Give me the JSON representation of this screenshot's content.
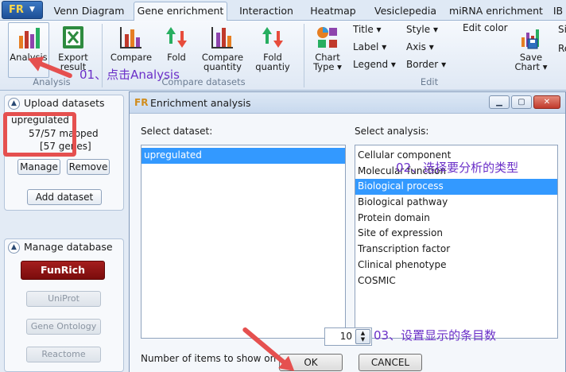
{
  "app": {
    "logo": "FR"
  },
  "tabs": [
    {
      "label": "Venn Diagram",
      "active": false
    },
    {
      "label": "Gene enrichment",
      "active": true
    },
    {
      "label": "Interaction",
      "active": false
    },
    {
      "label": "Heatmap",
      "active": false
    },
    {
      "label": "Vesiclepedia",
      "active": false
    },
    {
      "label": "miRNA enrichment",
      "active": false
    },
    {
      "label": "IB",
      "active": false
    }
  ],
  "ribbon": {
    "analysis_group": {
      "label": "Analysis",
      "analysis": "Analysis",
      "export": "Export",
      "export2": "result"
    },
    "compare_group": {
      "label": "Compare datasets",
      "compare": "Compare",
      "fold": "Fold",
      "compare_quantity": "Compare",
      "compare_quantity2": "quantity",
      "fold_quantity": "Fold",
      "fold_quantity2": "quantiy"
    },
    "edit_group": {
      "label": "Edit",
      "chart_type": "Chart",
      "chart_type2": "Type",
      "title": "Title",
      "label_btn": "Label",
      "legend": "Legend",
      "style": "Style",
      "axis": "Axis",
      "border": "Border",
      "edit_color": "Edit color",
      "save_chart": "Save",
      "save_chart2": "Chart",
      "right_partial1": "Si",
      "right_partial2": "Re"
    }
  },
  "upload": {
    "header": "Upload datasets",
    "dataset_name": "upregulated",
    "mapped": "57/57 mapped",
    "genes": "[57 genes]",
    "manage": "Manage",
    "remove": "Remove",
    "add": "Add dataset"
  },
  "database": {
    "header": "Manage database",
    "items": [
      "FunRich",
      "UniProt",
      "Gene Ontology",
      "Reactome"
    ]
  },
  "dialog": {
    "title": "Enrichment analysis",
    "select_dataset_label": "Select dataset:",
    "datasets": [
      "upregulated"
    ],
    "select_analysis_label": "Select analysis:",
    "analyses": [
      "Cellular component",
      "Molecular function",
      "Biological process",
      "Biological pathway",
      "Protein domain",
      "Site of expression",
      "Transcription factor",
      "Clinical phenotype",
      "COSMIC"
    ],
    "selected_analysis_index": 2,
    "items_label": "Number of items to show on chart:",
    "items_value": "10",
    "ok": "OK",
    "cancel": "CANCEL"
  },
  "annotations": {
    "step1": "01、点击Analysis",
    "step2": "02、选择要分析的类型",
    "step3": "03、设置显示的条目数"
  },
  "colors": {
    "accent_purple": "#6b30c8",
    "highlight_red": "#e5504f",
    "selection_blue": "#3399ff",
    "funrich_red": "#8b1010"
  }
}
